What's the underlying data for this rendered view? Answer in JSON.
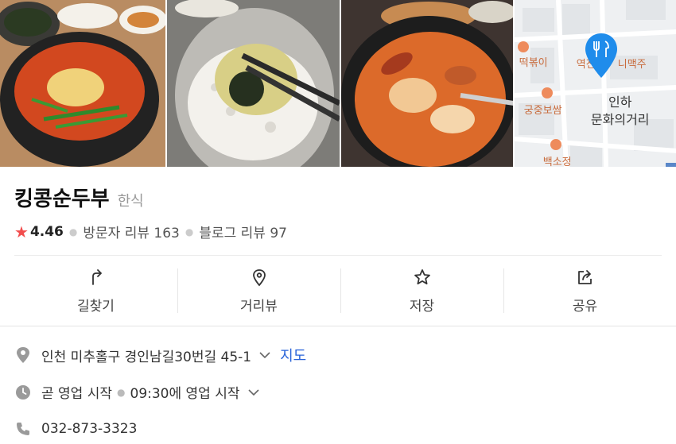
{
  "place": {
    "name": "킹콩순두부",
    "category": "한식",
    "rating": "4.46",
    "visitor_reviews_label": "방문자 리뷰",
    "visitor_reviews_count": "163",
    "blog_reviews_label": "블로그 리뷰",
    "blog_reviews_count": "97"
  },
  "actions": [
    {
      "label": "길찾기",
      "icon": "directions-icon"
    },
    {
      "label": "거리뷰",
      "icon": "street-view-icon"
    },
    {
      "label": "저장",
      "icon": "star-outline-icon"
    },
    {
      "label": "공유",
      "icon": "share-icon"
    }
  ],
  "info": {
    "address": "인천 미추홀구 경인남길30번길 45-1",
    "map_link": "지도",
    "hours_status": "곧 영업 시작",
    "hours_detail": "09:30에 영업 시작",
    "phone": "032-873-3323"
  },
  "map": {
    "labels": [
      "떡볶이",
      "궁중보쌈",
      "백소정",
      "역전",
      "니맥주"
    ],
    "area_line1": "인하",
    "area_line2": "문화의거리"
  },
  "colors": {
    "star": "#f24d4d",
    "link": "#2a64d9",
    "pin": "#1f8ceb"
  }
}
